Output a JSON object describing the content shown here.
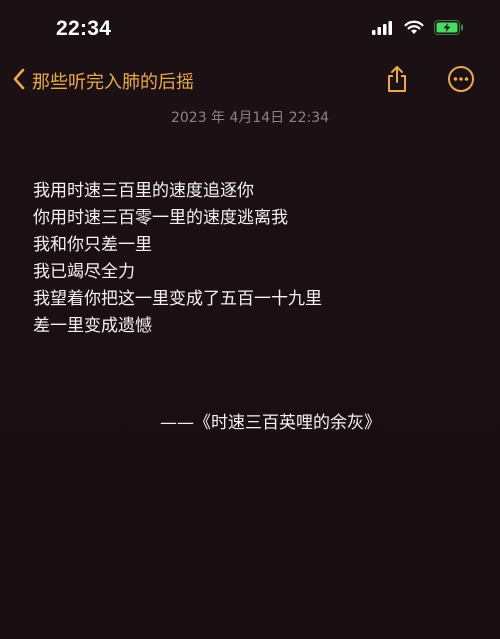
{
  "status_bar": {
    "time": "22:34",
    "icons": [
      "signal-icon",
      "wifi-icon",
      "battery-charging-icon"
    ],
    "battery_color": "#4cd964"
  },
  "nav": {
    "back_label": "那些听完入肺的后摇",
    "accent_color": "#e9a94f",
    "actions": [
      "share-icon",
      "more-icon"
    ]
  },
  "note": {
    "timestamp": "2023 年 4月14日 22:34",
    "lines": [
      "我用时速三百里的速度追逐你",
      "你用时速三百零一里的速度逃离我",
      "我和你只差一里",
      "我已竭尽全力",
      "我望着你把这一里变成了五百一十九里",
      "差一里变成遗憾"
    ],
    "attribution": "——《时速三百英哩的余灰》"
  }
}
